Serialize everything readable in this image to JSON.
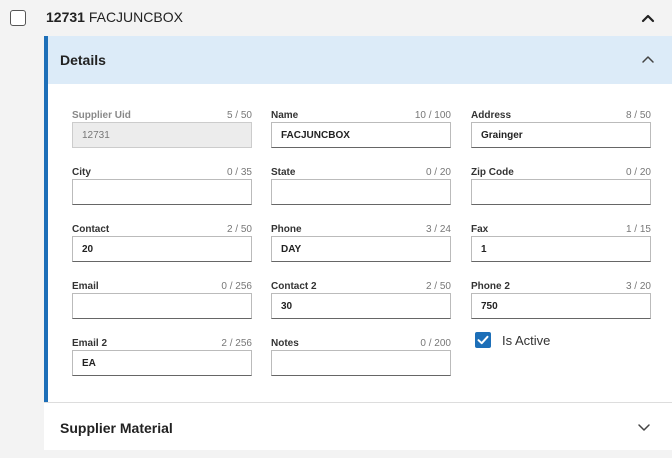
{
  "row": {
    "uid": "12731",
    "name": "FACJUNCBOX",
    "checked": false
  },
  "details": {
    "title": "Details"
  },
  "fields": {
    "supplier_uid": {
      "label": "Supplier Uid",
      "count": "5 / 50",
      "value": "12731"
    },
    "name": {
      "label": "Name",
      "count": "10 / 100",
      "value": "FACJUNCBOX"
    },
    "address": {
      "label": "Address",
      "count": "8 / 50",
      "value": "Grainger"
    },
    "city": {
      "label": "City",
      "count": "0 / 35",
      "value": ""
    },
    "state": {
      "label": "State",
      "count": "0 / 20",
      "value": ""
    },
    "zip": {
      "label": "Zip Code",
      "count": "0 / 20",
      "value": ""
    },
    "contact": {
      "label": "Contact",
      "count": "2 / 50",
      "value": "20"
    },
    "phone": {
      "label": "Phone",
      "count": "3 / 24",
      "value": "DAY"
    },
    "fax": {
      "label": "Fax",
      "count": "1 / 15",
      "value": "1"
    },
    "email": {
      "label": "Email",
      "count": "0 / 256",
      "value": ""
    },
    "contact2": {
      "label": "Contact 2",
      "count": "2 / 50",
      "value": "30"
    },
    "phone2": {
      "label": "Phone 2",
      "count": "3 / 20",
      "value": "750"
    },
    "email2": {
      "label": "Email 2",
      "count": "2 / 256",
      "value": "EA"
    },
    "notes": {
      "label": "Notes",
      "count": "0 / 200",
      "value": ""
    }
  },
  "is_active": {
    "label": "Is Active",
    "checked": true
  },
  "supplier_material": {
    "title": "Supplier Material"
  },
  "colors": {
    "accent": "#1d6fb8",
    "header_bg": "#dcebf8"
  },
  "icons": {
    "row_toggle": "chevron-up-icon",
    "details_toggle": "chevron-up-icon",
    "material_toggle": "chevron-down-icon",
    "check": "check-icon"
  }
}
